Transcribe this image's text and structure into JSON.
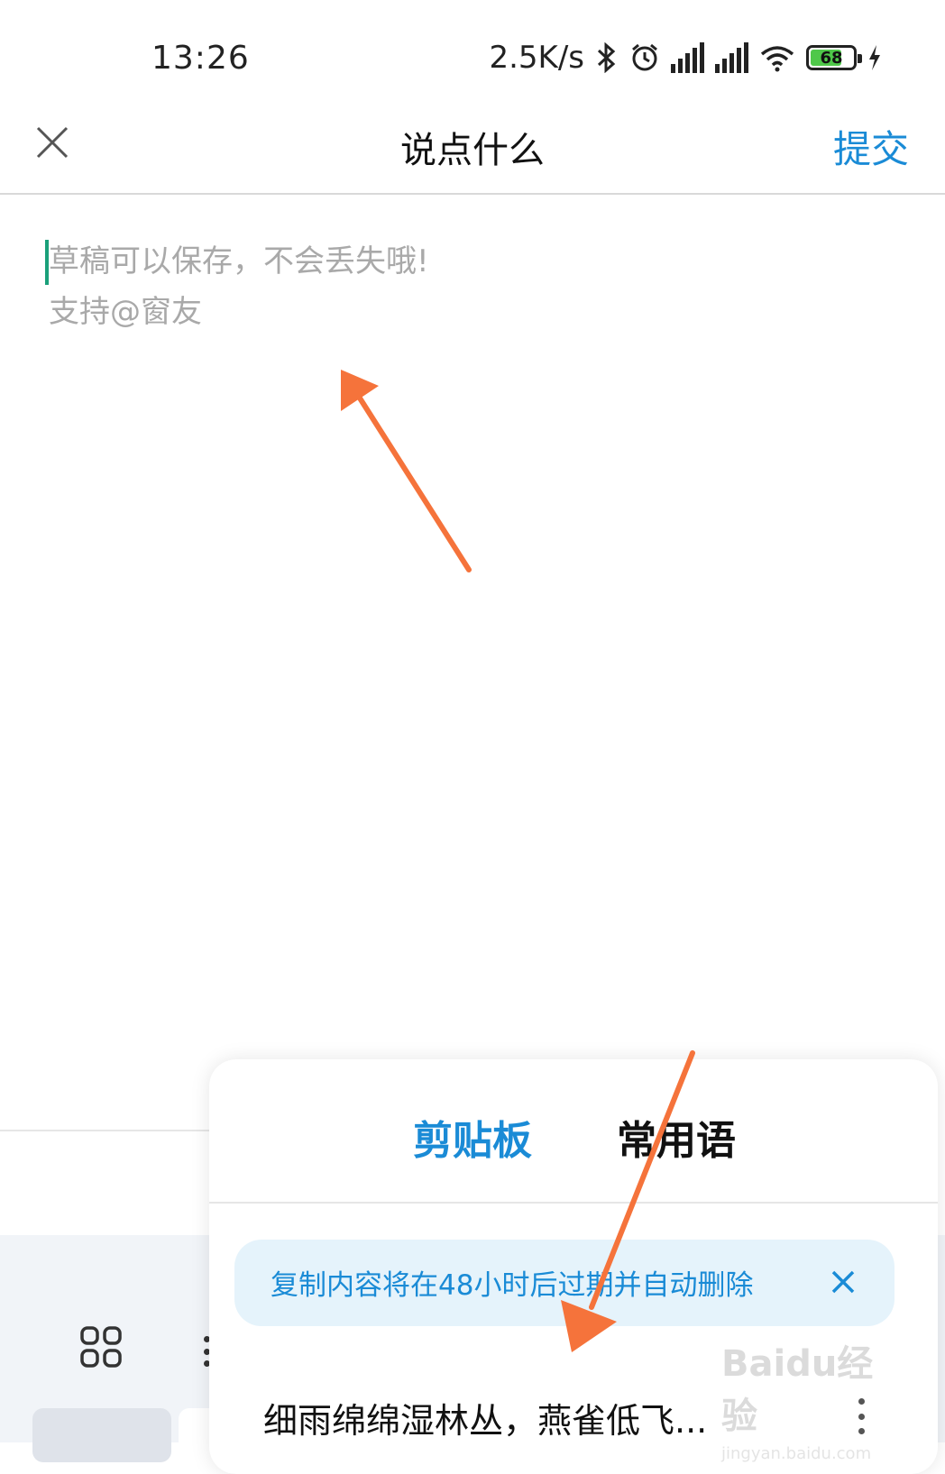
{
  "status_bar": {
    "time": "13:26",
    "net_speed": "2.5K/s",
    "battery_level": "68",
    "icons": [
      "bluetooth-icon",
      "alarm-icon",
      "hd-signal-icon",
      "hd-signal-icon",
      "wifi-icon",
      "battery-icon",
      "charging-icon"
    ]
  },
  "header": {
    "title": "说点什么",
    "submit_label": "提交"
  },
  "editor": {
    "placeholder_line1": "草稿可以保存，不会丢失哦!",
    "placeholder_line2": "支持@窗友"
  },
  "clipboard_panel": {
    "tabs": [
      {
        "label": "剪贴板",
        "active": true
      },
      {
        "label": "常用语",
        "active": false
      }
    ],
    "notice": "复制内容将在48小时后过期并自动删除",
    "items": [
      {
        "text": "细雨绵绵湿林丛，燕雀低飞..."
      }
    ]
  },
  "colors": {
    "accent": "#1a8bd6",
    "annotation_arrow": "#f5733b",
    "cursor": "#1aa07a"
  },
  "watermark": {
    "logo": "Baidu经验",
    "url": "jingyan.baidu.com"
  }
}
